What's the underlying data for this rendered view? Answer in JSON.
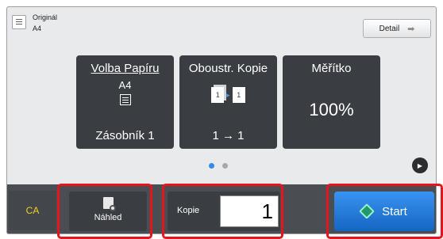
{
  "original": {
    "label": "Originál",
    "size": "A4",
    "icon": "document-icon"
  },
  "detail": {
    "label": "Detail",
    "icon": "arrow-right-icon"
  },
  "tiles": {
    "paper": {
      "title": "Volba Papíru",
      "size": "A4",
      "icon": "tray-icon",
      "value": "Zásobník 1"
    },
    "duplex": {
      "title": "Oboustr. Kopie",
      "icon": "duplex-pages-icon",
      "page_number": "1",
      "value": "1 → 1"
    },
    "scale": {
      "title": "Měřítko",
      "value": "100%"
    }
  },
  "pager": {
    "active_page": 1,
    "total_pages": 2
  },
  "bottom": {
    "ca_label": "CA",
    "preview_label": "Náhled",
    "preview_icon": "magnifier-icon",
    "copies_label": "Kopie",
    "copies_value": "1",
    "start_label": "Start",
    "start_icon": "diamond-icon"
  },
  "colors": {
    "accent_blue": "#2f8cea",
    "highlight_red": "#e5141d",
    "ca_yellow": "#f2d21c",
    "tile_dark": "#3a3d42"
  }
}
